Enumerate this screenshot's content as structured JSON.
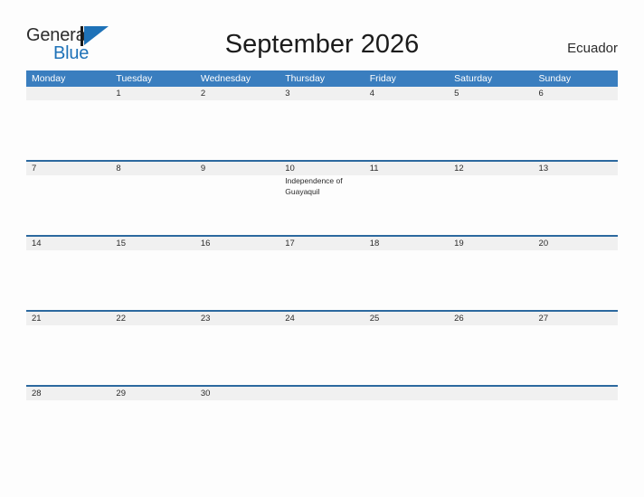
{
  "brand": {
    "name_part1": "General",
    "name_part2": "Blue",
    "mark": "triangle-flag-icon",
    "color_dark": "#2b2b2b",
    "color_blue": "#1e72b8"
  },
  "header": {
    "title": "September 2026",
    "country": "Ecuador"
  },
  "calendar": {
    "colors": {
      "header_bg": "#3a7ebf",
      "header_text": "#ffffff",
      "week_band_bg": "#f0f0f0",
      "week_band_border": "#2c699f",
      "page_bg": "#fdfdfd",
      "text": "#2b2b2b"
    },
    "day_headers": [
      "Monday",
      "Tuesday",
      "Wednesday",
      "Thursday",
      "Friday",
      "Saturday",
      "Sunday"
    ],
    "weeks": [
      {
        "days": [
          {
            "num": "",
            "events": []
          },
          {
            "num": "1",
            "events": []
          },
          {
            "num": "2",
            "events": []
          },
          {
            "num": "3",
            "events": []
          },
          {
            "num": "4",
            "events": []
          },
          {
            "num": "5",
            "events": []
          },
          {
            "num": "6",
            "events": []
          }
        ]
      },
      {
        "days": [
          {
            "num": "7",
            "events": []
          },
          {
            "num": "8",
            "events": []
          },
          {
            "num": "9",
            "events": []
          },
          {
            "num": "10",
            "events": [
              "Independence of Guayaquil"
            ]
          },
          {
            "num": "11",
            "events": []
          },
          {
            "num": "12",
            "events": []
          },
          {
            "num": "13",
            "events": []
          }
        ]
      },
      {
        "days": [
          {
            "num": "14",
            "events": []
          },
          {
            "num": "15",
            "events": []
          },
          {
            "num": "16",
            "events": []
          },
          {
            "num": "17",
            "events": []
          },
          {
            "num": "18",
            "events": []
          },
          {
            "num": "19",
            "events": []
          },
          {
            "num": "20",
            "events": []
          }
        ]
      },
      {
        "days": [
          {
            "num": "21",
            "events": []
          },
          {
            "num": "22",
            "events": []
          },
          {
            "num": "23",
            "events": []
          },
          {
            "num": "24",
            "events": []
          },
          {
            "num": "25",
            "events": []
          },
          {
            "num": "26",
            "events": []
          },
          {
            "num": "27",
            "events": []
          }
        ]
      },
      {
        "days": [
          {
            "num": "28",
            "events": []
          },
          {
            "num": "29",
            "events": []
          },
          {
            "num": "30",
            "events": []
          },
          {
            "num": "",
            "events": []
          },
          {
            "num": "",
            "events": []
          },
          {
            "num": "",
            "events": []
          },
          {
            "num": "",
            "events": []
          }
        ]
      }
    ]
  }
}
